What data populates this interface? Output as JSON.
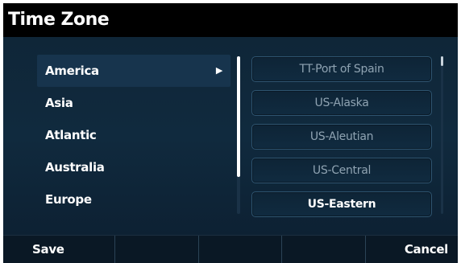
{
  "header": {
    "title": "Time Zone"
  },
  "regions": {
    "items": [
      {
        "label": "America",
        "selected": true
      },
      {
        "label": "Asia"
      },
      {
        "label": "Atlantic"
      },
      {
        "label": "Australia"
      },
      {
        "label": "Europe"
      }
    ],
    "arrow_icon": "triangle-right-icon"
  },
  "zones": {
    "items": [
      {
        "label": "TT-Port of Spain"
      },
      {
        "label": "US-Alaska"
      },
      {
        "label": "US-Aleutian"
      },
      {
        "label": "US-Central"
      },
      {
        "label": "US-Eastern",
        "current": true
      }
    ]
  },
  "softkeys": {
    "save_label": "Save",
    "cancel_label": "Cancel"
  },
  "colors": {
    "title_bar": "#000000",
    "background": "#0f2638",
    "selected_row": "#17344d",
    "zone_border": "#2e5470",
    "dim_text": "#8fa3b2"
  }
}
